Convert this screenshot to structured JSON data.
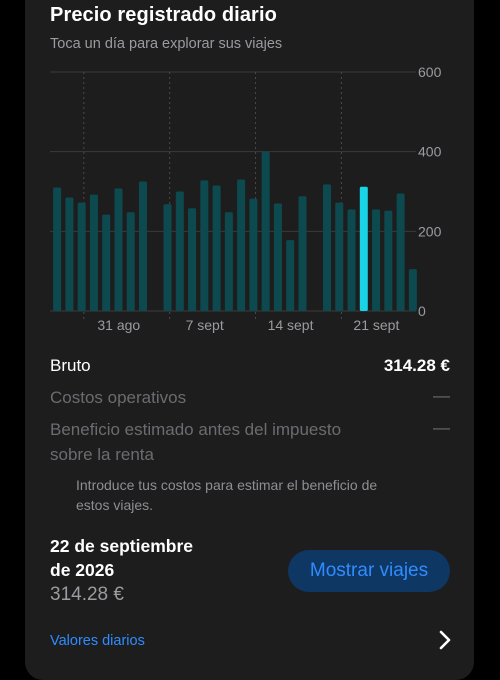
{
  "header": {
    "title": "Precio registrado diario",
    "subtitle": "Toca un día para explorar sus viajes"
  },
  "chart_data": {
    "type": "bar",
    "x_tick_labels": [
      "31 ago",
      "7 sept",
      "14 sept",
      "21 sept"
    ],
    "y_tick_labels": [
      "0",
      "200",
      "400",
      "600"
    ],
    "ylim": [
      0,
      600
    ],
    "grid": true,
    "selected_index": 25,
    "values": [
      310,
      285,
      272,
      292,
      242,
      308,
      248,
      325,
      null,
      268,
      300,
      258,
      328,
      315,
      248,
      330,
      282,
      400,
      270,
      178,
      288,
      null,
      318,
      272,
      255,
      312,
      255,
      252,
      295,
      105
    ],
    "colors": {
      "bar": "#0d4a50",
      "selected": "#19d3e6",
      "grid": "#3a3a3c",
      "tick": "#9b9ba0"
    }
  },
  "summary": {
    "gross_label": "Bruto",
    "gross_value": "314.28 €",
    "costs_label": "Costos operativos",
    "costs_value": "—",
    "profit_label_line1": "Beneficio estimado antes del impuesto",
    "profit_label_line2": "sobre la renta",
    "profit_value": "—",
    "hint_line1": "Introduce tus costos para estimar el beneficio de",
    "hint_line2": "estos viajes."
  },
  "selection": {
    "date_line1": "22 de septiembre",
    "date_line2": "de 2026",
    "amount": "314.28 €",
    "show_trips_label": "Mostrar viajes"
  },
  "footer": {
    "daily_values_label": "Valores diarios",
    "chevron_icon": "chevron-right-icon"
  }
}
